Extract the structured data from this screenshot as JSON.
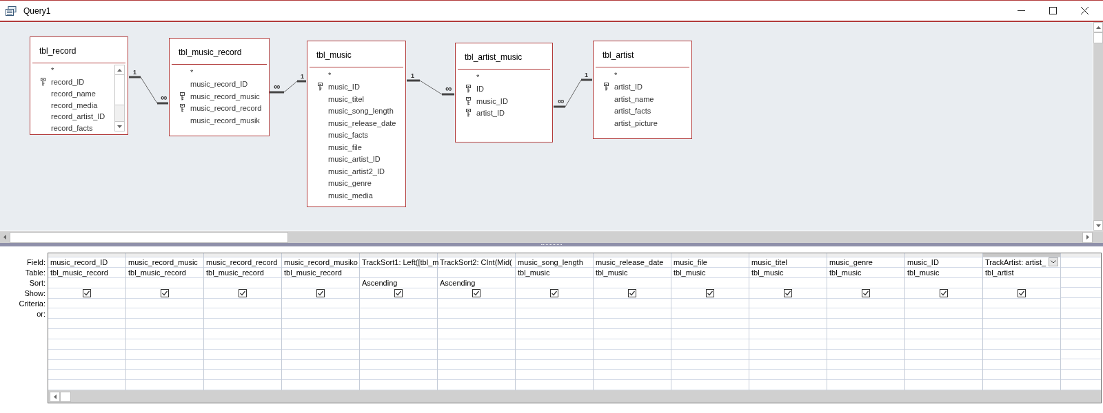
{
  "window": {
    "title": "Query1"
  },
  "tables": [
    {
      "name": "tbl_record",
      "scrollable": true,
      "fields": [
        {
          "name": "*",
          "key": false
        },
        {
          "name": "record_ID",
          "key": true
        },
        {
          "name": "record_name",
          "key": false
        },
        {
          "name": "record_media",
          "key": false
        },
        {
          "name": "record_artist_ID",
          "key": false
        },
        {
          "name": "record_facts",
          "key": false
        }
      ]
    },
    {
      "name": "tbl_music_record",
      "scrollable": false,
      "fields": [
        {
          "name": "*",
          "key": false
        },
        {
          "name": "music_record_ID",
          "key": false
        },
        {
          "name": "music_record_music",
          "key": true
        },
        {
          "name": "music_record_record",
          "key": true
        },
        {
          "name": "music_record_musik",
          "key": false
        }
      ]
    },
    {
      "name": "tbl_music",
      "scrollable": false,
      "fields": [
        {
          "name": "*",
          "key": false
        },
        {
          "name": "music_ID",
          "key": true
        },
        {
          "name": "music_titel",
          "key": false
        },
        {
          "name": "music_song_length",
          "key": false
        },
        {
          "name": "music_release_date",
          "key": false
        },
        {
          "name": "music_facts",
          "key": false
        },
        {
          "name": "music_file",
          "key": false
        },
        {
          "name": "music_artist_ID",
          "key": false
        },
        {
          "name": "music_artist2_ID",
          "key": false
        },
        {
          "name": "music_genre",
          "key": false
        },
        {
          "name": "music_media",
          "key": false
        }
      ]
    },
    {
      "name": "tbl_artist_music",
      "scrollable": false,
      "fields": [
        {
          "name": "*",
          "key": false
        },
        {
          "name": "ID",
          "key": true
        },
        {
          "name": "music_ID",
          "key": true
        },
        {
          "name": "artist_ID",
          "key": true
        }
      ]
    },
    {
      "name": "tbl_artist",
      "scrollable": false,
      "fields": [
        {
          "name": "*",
          "key": false
        },
        {
          "name": "artist_ID",
          "key": true
        },
        {
          "name": "artist_name",
          "key": false
        },
        {
          "name": "artist_facts",
          "key": false
        },
        {
          "name": "artist_picture",
          "key": false
        }
      ]
    }
  ],
  "relationships": [
    {
      "one_label": "1",
      "many_label": "∞"
    },
    {
      "one_label": "1",
      "many_label": "∞"
    },
    {
      "one_label": "1",
      "many_label": "∞"
    },
    {
      "one_label": "1",
      "many_label": "∞"
    }
  ],
  "grid": {
    "row_labels": [
      "Field:",
      "Table:",
      "Sort:",
      "Show:",
      "Criteria:",
      "or:"
    ],
    "columns": [
      {
        "field": "music_record_ID",
        "table": "tbl_music_record",
        "show": true,
        "selected": false
      },
      {
        "field": "music_record_music",
        "table": "tbl_music_record",
        "show": true,
        "selected": false
      },
      {
        "field": "music_record_record",
        "table": "tbl_music_record",
        "show": true,
        "selected": false
      },
      {
        "field": "music_record_musiko",
        "table": "tbl_music_record",
        "show": true,
        "selected": false
      },
      {
        "field": "TrackSort1: Left([tbl_m",
        "sort": "Ascending",
        "show": true,
        "selected": false
      },
      {
        "field": "TrackSort2: CInt(Mid(",
        "sort": "Ascending",
        "show": true,
        "selected": false
      },
      {
        "field": "music_song_length",
        "table": "tbl_music",
        "show": true,
        "selected": false
      },
      {
        "field": "music_release_date",
        "table": "tbl_music",
        "show": true,
        "selected": false
      },
      {
        "field": "music_file",
        "table": "tbl_music",
        "show": true,
        "selected": false
      },
      {
        "field": "music_titel",
        "table": "tbl_music",
        "show": true,
        "selected": false
      },
      {
        "field": "music_genre",
        "table": "tbl_music",
        "show": true,
        "selected": false
      },
      {
        "field": "music_ID",
        "table": "tbl_music",
        "show": true,
        "selected": false
      },
      {
        "field": "TrackArtist: artist_",
        "table": "tbl_artist",
        "show": true,
        "selected": true
      }
    ]
  }
}
